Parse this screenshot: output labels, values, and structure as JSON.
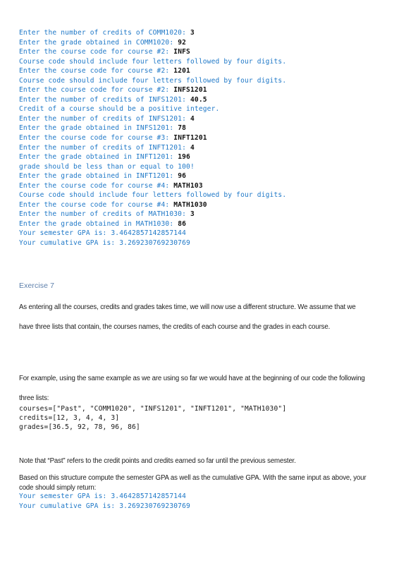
{
  "document": {
    "background_color": "#ffffff",
    "prompt_color": "#2079c8",
    "input_color": "#111111",
    "heading_color": "#5d7fab",
    "body_color": "#1b1b1b",
    "code_color": "#161616"
  },
  "console_transcript": [
    {
      "prompt": "Enter the number of credits of COMM1020: ",
      "input": "3"
    },
    {
      "prompt": "Enter the grade obtained in COMM1020: ",
      "input": "92"
    },
    {
      "prompt": "Enter the course code for course #2: ",
      "input": "INFS"
    },
    {
      "prompt": "Course code should include four letters followed by four digits.",
      "input": ""
    },
    {
      "prompt": "Enter the course code for course #2: ",
      "input": "1201"
    },
    {
      "prompt": "Course code should include four letters followed by four digits.",
      "input": ""
    },
    {
      "prompt": "Enter the course code for course #2: ",
      "input": "INFS1201"
    },
    {
      "prompt": "Enter the number of credits of INFS1201: ",
      "input": "40.5"
    },
    {
      "prompt": "Credit of a course should be a positive integer.",
      "input": ""
    },
    {
      "prompt": "Enter the number of credits of INFS1201: ",
      "input": "4"
    },
    {
      "prompt": "Enter the grade obtained in INFS1201: ",
      "input": "78"
    },
    {
      "prompt": "Enter the course code for course #3: ",
      "input": "INFT1201"
    },
    {
      "prompt": "Enter the number of credits of INFT1201: ",
      "input": "4"
    },
    {
      "prompt": "Enter the grade obtained in INFT1201: ",
      "input": "196"
    },
    {
      "prompt": "grade should be less than or equal to 100!",
      "input": ""
    },
    {
      "prompt": "Enter the grade obtained in INFT1201: ",
      "input": "96"
    },
    {
      "prompt": "Enter the course code for course #4: ",
      "input": "MATH103"
    },
    {
      "prompt": "Course code should include four letters followed by four digits.",
      "input": ""
    },
    {
      "prompt": "Enter the course code for course #4: ",
      "input": "MATH1030"
    },
    {
      "prompt": "Enter the number of credits of MATH1030: ",
      "input": "3"
    },
    {
      "prompt": "Enter the grade obtained in MATH1030: ",
      "input": "86"
    },
    {
      "prompt": "Your semester GPA is: 3.4642857142857144",
      "input": ""
    },
    {
      "prompt": "Your cumulative GPA is: 3.269230769230769",
      "input": ""
    }
  ],
  "exercise": {
    "heading": "Exercise 7",
    "paragraph_1": "As entering all the courses, credits and grades takes time, we will now use a different structure. We assume that we have three lists that contain, the courses names, the credits of each course and the grades in each course.",
    "paragraph_2": "For example, using the same example as we are using so far we would have at the beginning of our code the following three lists:",
    "code_lines": [
      "courses=[\"Past\", \"COMM1020\", \"INFS1201\", \"INFT1201\", \"MATH1030\"]",
      "credits=[12, 3, 4, 4, 3]",
      "grades=[36.5, 92, 78, 96, 86]"
    ],
    "note": "Note that “Past” refers to the credit points and credits earned so far until the previous semester.",
    "instruction": "Based on this structure compute the semester GPA as well as the cumulative GPA. With the same input as above, your code should simply return:",
    "expected_output": [
      "Your semester GPA is: 3.4642857142857144",
      "Your cumulative GPA is: 3.269230769230769"
    ]
  }
}
